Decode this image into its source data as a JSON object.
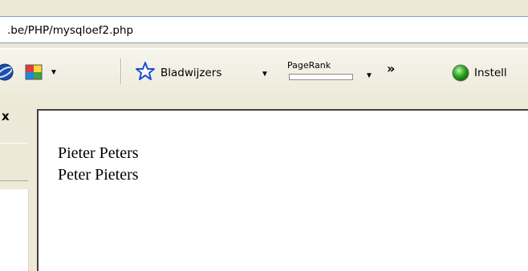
{
  "address_bar": {
    "url": ".be/PHP/mysqloef2.php"
  },
  "toolbar": {
    "bookmarks_label": "Bladwijzers",
    "pagerank_label": "PageRank",
    "pagerank_value": 0,
    "overflow_chevrons": "»",
    "settings_label": "Instell",
    "icons": [
      "globe-icon",
      "colors-icon",
      "star-icon",
      "green-status-icon"
    ],
    "accent_colors": {
      "star": "#1d4ed8",
      "status_green": "#2eaa22",
      "pagerank_bar_border": "#8d8d8d"
    }
  },
  "sidebar": {
    "close_glyph": "x"
  },
  "page": {
    "lines": [
      "Pieter Peters",
      "Peter Pieters"
    ]
  }
}
